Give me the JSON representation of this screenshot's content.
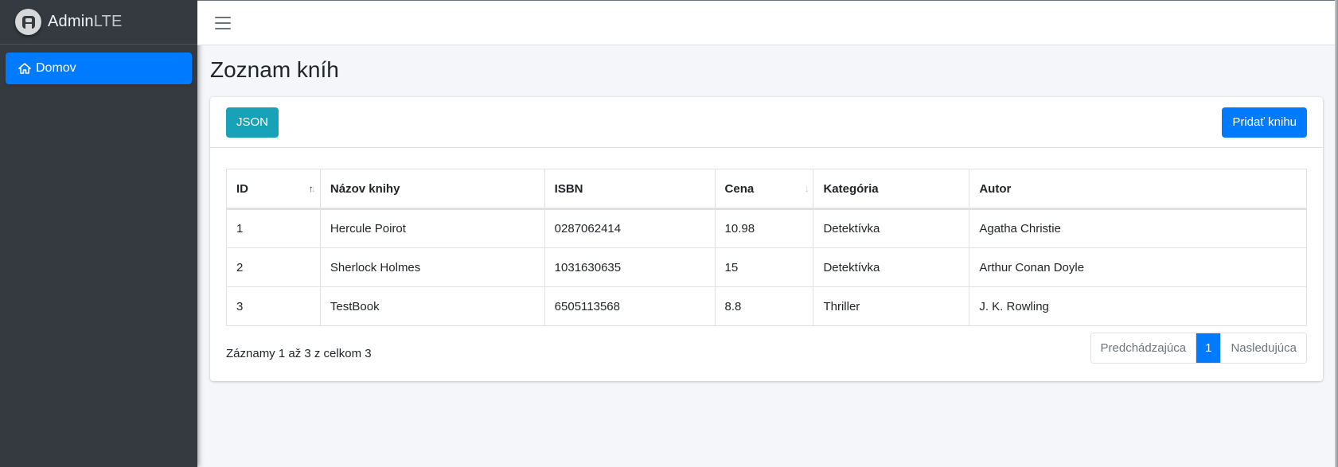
{
  "brand": {
    "name_bold": "Admin",
    "name_light": "LTE",
    "logo_icon": "adminlte-logo-icon"
  },
  "sidebar": {
    "items": [
      {
        "label": "Domov",
        "icon": "home-icon",
        "active": true
      }
    ]
  },
  "topbar": {
    "menu_icon": "hamburger-menu-icon"
  },
  "page": {
    "title": "Zoznam kníh"
  },
  "toolbar": {
    "json_label": "JSON",
    "add_label": "Pridať knihu"
  },
  "table": {
    "columns": [
      {
        "label": "ID",
        "sortable": true,
        "sort": "asc"
      },
      {
        "label": "Názov knihy"
      },
      {
        "label": "ISBN"
      },
      {
        "label": "Cena",
        "sortable": true,
        "sort": "none"
      },
      {
        "label": "Kategória"
      },
      {
        "label": "Autor"
      }
    ],
    "rows": [
      [
        "1",
        "Hercule Poirot",
        "0287062414",
        "10.98",
        "Detektívka",
        "Agatha Christie"
      ],
      [
        "2",
        "Sherlock Holmes",
        "1031630635",
        "15",
        "Detektívka",
        "Arthur Conan Doyle"
      ],
      [
        "3",
        "TestBook",
        "6505113568",
        "8.8",
        "Thriller",
        "J. K. Rowling"
      ]
    ]
  },
  "footer": {
    "info": "Záznamy 1 až 3 z celkom 3",
    "prev_label": "Predchádzajúca",
    "current_page": "1",
    "next_label": "Nasledujúca"
  },
  "colors": {
    "primary": "#007bff",
    "info": "#17a2b8",
    "sidebar": "#343a40"
  }
}
